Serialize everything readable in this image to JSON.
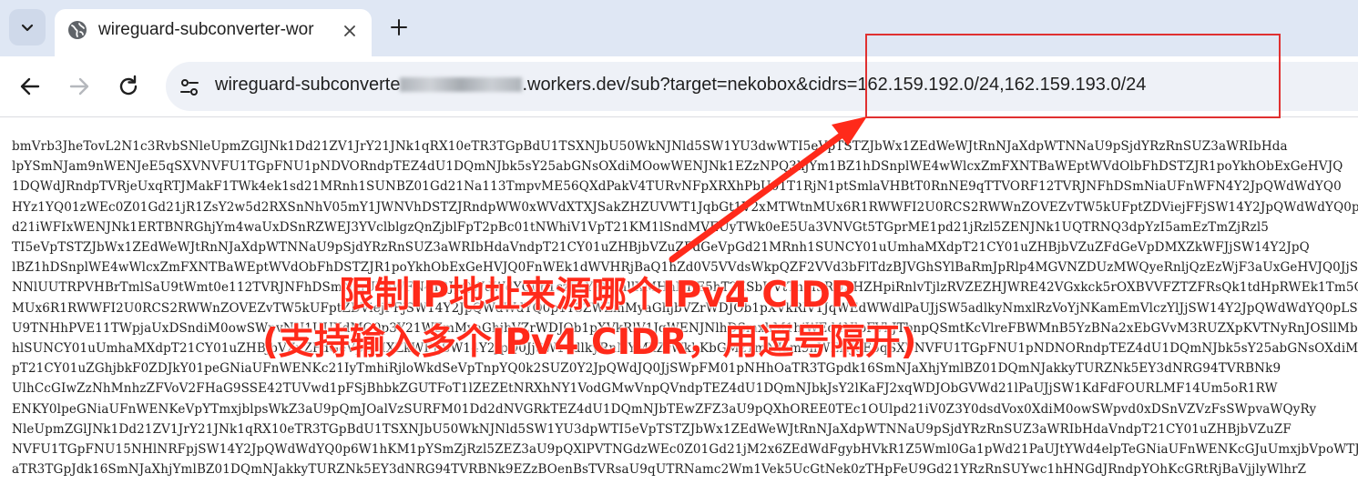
{
  "tab": {
    "title": "wireguard-subconverter-wor",
    "close_label": "✕",
    "new_tab_label": "+"
  },
  "toolbar": {
    "url_prefix": "wireguard-subconverte",
    "url_suffix": ".workers.dev/sub?target=nekobox&cidrs=162.159.192.0/24,162.159.193.0/24"
  },
  "icons": {
    "tab_dropdown": "chevron-down-icon",
    "favicon": "globe-icon",
    "back": "back-arrow-icon",
    "forward": "forward-arrow-icon",
    "reload": "reload-icon",
    "site_info": "tune-icon"
  },
  "colors": {
    "annotation": "#ff2a1a",
    "tabstrip": "#dfe7f4",
    "omnibox": "#eef1f7"
  },
  "annotation": {
    "line1": "限制IP地址来源哪个IPv4 CIDR",
    "line2": "(支持输入多个IPv4 CIDR，用逗号隔开)"
  },
  "content_lines": [
    "bmVrb3JheTovL2N1c3RvbSNleUpmZGlJNk1Dd21ZV1JrY21JNk1qRX10eTR3TGpBdU1TSXNJbU50WkNJNld5SW1YU3dwWTI5eVpTSTZJbWx1ZEdWeWJtRnNJaXdpWTNNaU9pSjdYRzRnSUZ3aWRIbHda",
    "lpYSmNJam9nWENJeE5qSXVNVFU1TGpFNU1pNDVORndpTEZ4dU1DQmNJbk5sY25abGNsOXdiMOowWENJNk1EZzNPQ3hjYm1BZ1hDSnplWE4wWlcxZmFXNTBaWEptWVdOlbFhDSTZJR1poYkhObExGeHVJQ",
    "1DQWdJRndpTVRjeUxqRTJMakF1TWk4ek1sd21MRnh1SUNBZ01Gd21Na113TmpvME56QXdPakV4TURvNFpXRXhPbU01T1RjN1ptSmlaVHBtT0RnNE9qTTVORF12TVRJNFhDSmNiaUFnWFN4Y2JpQWdWdYQ0",
    "HYz1YQ01zWEc0Z01Gd21jR1ZsY2w5d2RXSnNhV05mY1JWNVhDSTZJRndpWW0xWVdXTXJSakZHZUVWT1JqbGt1V2xMTWtnMUx6R1RWWFI2U0RCS2RWWnZOVEZvTW5kUFptZDViejFFjSW14Y2JpQWdWdYQ0p",
    "d21iWFIxWENJNk1ERTBNRGhjYm4waUxDSnRZWEJ3YVclblgzQnZjblFpT2pBc01tNWhiV1VpT21KM1lSndMVEUyTWk0eE5Ua3VNVGt5TGprME1pd21jRzl5ZENJNk1UQTRNQ3dpYzI5amEzTmZjRzl5",
    "TI5eVpTSTZJbWx1ZEdWeWJtRnNJaXdpWTNNaU9pSjdYRzRnSUZ3aWRIbHdaVndpT21CY01uZHBjbVZuZFdGeVpGd21MRnh1SUNCY01uUmhaMXdpT21CY01uZHBjbVZuZFdGeVpDMXZkWFJjSW14Y2JpQ",
    "lBZ1hDSnplWE4wWlcxZmFXNTBaWEptWVdObFhDSTZJR1poYkhObExGeHVJQ0FnWEk1dWVHRjBaQ1hZd0V5VVdsWkpQZF2VVd3bFlTdzBJVGhSYlBaRmJpRlp4MGVNZDUzMWQyeRnljQzEzWjF3aUxGeHVJQ0JjSW14dlkyRnNYMkZrWkhKbGMzTmNJam9nV",
    "NNlUUTRPVHBrTmlSaU9tWmt0e112TVRJNFhDSmNiaUFnWFN4Y2JpQWdWdYQ0p1czFvYzNSallXMHhNRE5hT2ZSbUVtTnM3RUZHZHpiRnlvTjlzRVZEZHJWRE42VGxkck5rOXBVVFZTZFRsQk1tdHpRWEk1Tm5OUWVIaH1",
    "MUx6R1RWWFI2U0RCS2RWWnZOVEZvTW5kUFptZDViejFFjSW14Y2JpQWdWdYQ0p1Y3ZWZmMyaGhjbVZrWDJOb1pXVkRlV1JqWEdWWdlPaUJjSW5adlkyNmxlRzVoYjNKamEmVlczYlJjSW14Y2JpQWdWdYQ0pLSW5KbGMyVnlkbVZrWENJNk1GczBNaXdnTnpZc01ETXl",
    "U9TNHhPVE11TWpjaUxDSndiM0owSWpvNU1UUXdMQ0p3Y21WZmMyaGhjbVZrWDJOb1pXVkRlV1JqWENJNlhDSmxhM1hjWEd4NlpFVkJTbnpQSmtKcVlreFBWMnB5YzBNa2xEbGVvM3RUZXpKVTNyRnJOSllMb2R3OU1aR1JJNk1qRX10eTR3TGpBdU1TSXNJbU50WkNJNk",
    "hlSUNCY01uUmhaMXdpT21CY01uZHBjbVZuZFdGeVpDMXZkWFJjSW14Y2JpQ0JjSW14dlkyRnNYMkZrWkhKbGMzTmNJam9nWENJeE5qSXVNVFU1TGpFNU1pNDNORndpTEZ4dU1DQmNJbk5sY25abGNsOXdiMOowWENJNk",
    "pT21CY01uZGhjbkF0ZDJkY01peGNiaUFnWENKc21IyTmhiRjloWkdSeVpTnpYQ0k2SUZ0Y2JpQWdJQ0JjSWpFM01pNHhOaTR3TGpdk16SmNJaXhjYmlBZ01DQmNJakkyTURZNk5EY3dNRG94TVRBNk9",
    "UlhCcGIwZzNhMnhzZFVoV2FHaG9SSE42TUVwd1pFSjBhbkZGUTFoT1lZEZEtNRXhNY1VodGMwVnpQVndpTEZ4dU1DQmNJbkJsY2lKaFJ2xqWDJObGVWd21lPaUJjSW1KdFdFOURLMF14Um5oR1RW",
    "ENKY0lpeGNiaUFnWENKeVpYTmxjblpsWkZ3aU9pQmJOalVzSURFM01Dd2dNVGRkTEZ4dU1DQmNJbTEwZFZ3aU9pQXhOREE0TEc1OUlpd21iV0Z3Y0dsdVox0XdiM0owSWpvd0xDSnVZVzFsSWpvaWQyRy",
    "NleUpmZGlJNk1Dd21ZV1JrY21JNk1qRX10eTR3TGpBdU1TSXNJbU50WkNJNld5SW1YU3dpWTI5eVpTSTZJbWx1ZEdWeWJtRnNJaXdpWTNNaU9pSjdYRzRnSUZ3aWRIbHdaVndpT21CY01uZHBjbVZuZF",
    "NVFU1TGpFNU15NHlNRFpjSW14Y2JpQWdWdYQ0p6W1hKM1pYSmZjRzl5ZEZ3aU9pQXlPVTNGdzWEc0Z01Gd21jM2x6ZEdWdFgybHVkR1Z5Wml0Ga1pWd21PaUJtYWd4elpTeGNiaUFnWENKcGJuUmxjbVpoWTJ",
    "aTR3TGpJdk16SmNJaXhjYmlBZ01DQmNJakkyTURZNk5EY3dNRG94TVRBNk9EZzBOenBsTVRsaU9qUTRNamc2Wm1Vek5UcGtNek0zTHpFeU9Gd21YRzRnSUYwc1hHNGdJRndpYOhKcGRtRjBaVjjlyWlhrZ"
  ]
}
